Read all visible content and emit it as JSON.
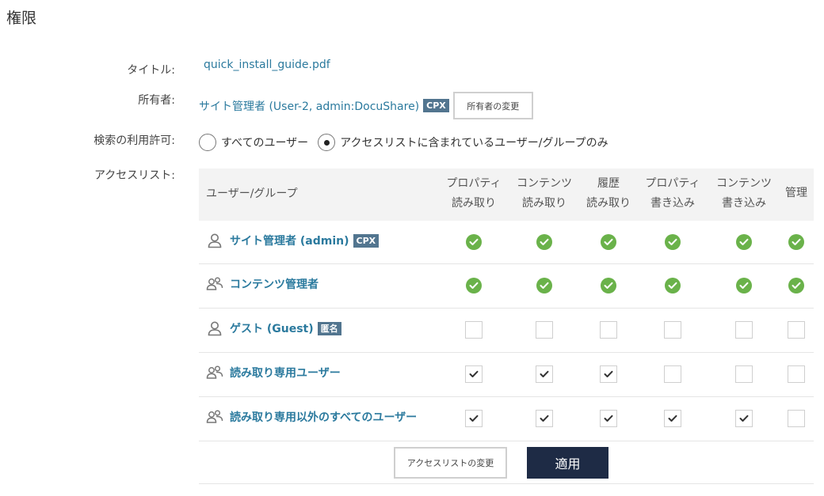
{
  "page": {
    "title": "権限"
  },
  "labels": {
    "title": "タイトル:",
    "owner": "所有者:",
    "search_permission": "検索の利用許可:",
    "access_list": "アクセスリスト:"
  },
  "document": {
    "title": "quick_install_guide.pdf"
  },
  "owner": {
    "name": "サイト管理者 (User-2, admin:DocuShare)",
    "badge": "CPX",
    "change_button": "所有者の変更"
  },
  "search": {
    "options": [
      {
        "label": "すべてのユーザー",
        "selected": false
      },
      {
        "label": "アクセスリストに含まれているユーザー/グループのみ",
        "selected": true
      }
    ]
  },
  "acl": {
    "user_group_header": "ユーザー/グループ",
    "columns": [
      {
        "line1": "プロパティ",
        "line2": "読み取り"
      },
      {
        "line1": "コンテンツ",
        "line2": "読み取り"
      },
      {
        "line1": "履歴",
        "line2": "読み取り"
      },
      {
        "line1": "プロパティ",
        "line2": "書き込み"
      },
      {
        "line1": "コンテンツ",
        "line2": "書き込み"
      },
      {
        "line1": "管理",
        "line2": ""
      }
    ],
    "rows": [
      {
        "name": "サイト管理者 (admin)",
        "badge": "CPX",
        "icon": "user-icon",
        "perms": [
          "granted-locked",
          "granted-locked",
          "granted-locked",
          "granted-locked",
          "granted-locked",
          "granted-locked"
        ]
      },
      {
        "name": "コンテンツ管理者",
        "badge": "",
        "icon": "group-icon",
        "perms": [
          "granted-locked",
          "granted-locked",
          "granted-locked",
          "granted-locked",
          "granted-locked",
          "granted-locked"
        ]
      },
      {
        "name": "ゲスト (Guest)",
        "badge": "匿名",
        "icon": "user-icon",
        "perms": [
          "unchecked",
          "unchecked",
          "unchecked",
          "unchecked",
          "unchecked",
          "unchecked"
        ]
      },
      {
        "name": "読み取り専用ユーザー",
        "badge": "",
        "icon": "group-icon",
        "perms": [
          "checked",
          "checked",
          "checked",
          "unchecked",
          "unchecked",
          "unchecked"
        ]
      },
      {
        "name": "読み取り専用以外のすべてのユーザー",
        "badge": "",
        "icon": "group-icon",
        "perms": [
          "checked",
          "checked",
          "checked",
          "checked",
          "checked",
          "unchecked"
        ]
      }
    ]
  },
  "footer": {
    "change_acl_button": "アクセスリストの変更",
    "apply_button": "適用"
  },
  "colors": {
    "link": "#2b7a9e",
    "badge": "#52758f",
    "granted": "#6ab24a",
    "apply": "#1e2b45"
  }
}
